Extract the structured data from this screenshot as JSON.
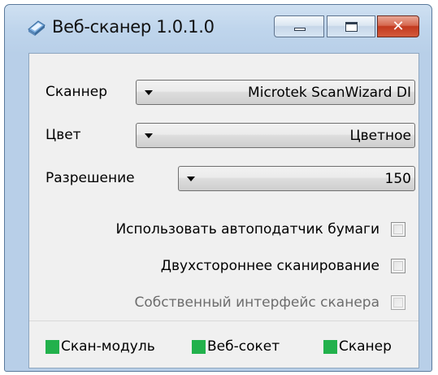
{
  "window": {
    "title": "Веб-сканер 1.0.1.0",
    "icon": "scanner-app-icon"
  },
  "form": {
    "scanner": {
      "label": "Сканнер",
      "value": "Microtek ScanWizard DI"
    },
    "color": {
      "label": "Цвет",
      "value": "Цветное"
    },
    "resolution": {
      "label": "Разрешение",
      "value": "150"
    }
  },
  "options": {
    "auto_feeder": {
      "label": "Использовать автоподатчик бумаги",
      "checked": false,
      "enabled": true
    },
    "duplex": {
      "label": "Двухстороннее сканирование",
      "checked": false,
      "enabled": true
    },
    "native_ui": {
      "label": "Собственный интерфейс сканера",
      "checked": false,
      "enabled": false
    }
  },
  "status": {
    "items": [
      {
        "label": "Скан-модуль",
        "color": "#22b14c"
      },
      {
        "label": "Веб-сокет",
        "color": "#22b14c"
      },
      {
        "label": "Сканер",
        "color": "#22b14c"
      }
    ]
  }
}
